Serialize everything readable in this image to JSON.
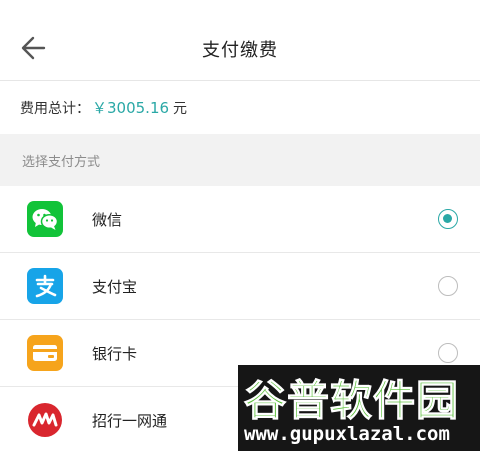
{
  "header": {
    "title": "支付缴费",
    "back_icon": "arrow-left-icon"
  },
  "total": {
    "label": "费用总计：",
    "amount": "￥3005.16",
    "unit": "元",
    "amount_color": "#2aa8a6"
  },
  "section": {
    "title": "选择支付方式"
  },
  "methods": [
    {
      "label": "微信",
      "icon": "wechat-icon",
      "color": "#12c339",
      "selected": true
    },
    {
      "label": "支付宝",
      "icon": "alipay-icon",
      "color": "#17a4e8",
      "selected": false
    },
    {
      "label": "银行卡",
      "icon": "bank-card-icon",
      "color": "#f6a41c",
      "selected": false
    },
    {
      "label": "招行一网通",
      "icon": "cmb-icon",
      "color": "#d9262e",
      "selected": false
    }
  ],
  "watermark": {
    "name": "谷普软件园",
    "url": "www.gupuxlazal.com"
  },
  "colors": {
    "accent": "#2aa8a6",
    "divider": "#e8e8e8",
    "section_bg": "#f2f2f2"
  }
}
